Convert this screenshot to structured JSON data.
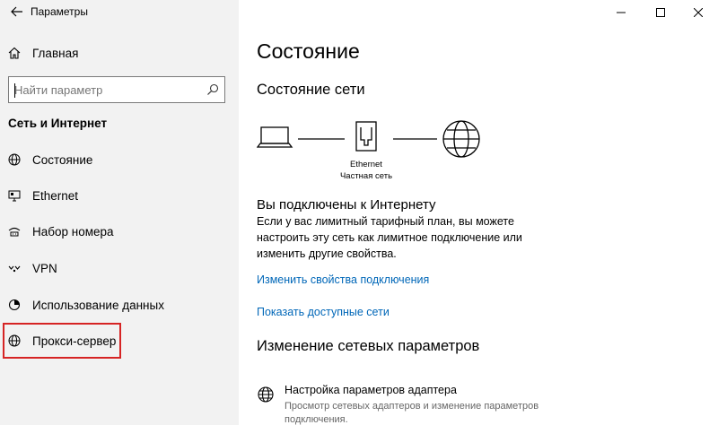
{
  "window": {
    "title": "Параметры",
    "controls": [
      "minimize-icon",
      "maximize-icon",
      "close-icon"
    ]
  },
  "sidebar": {
    "home_label": "Главная",
    "search": {
      "placeholder": "Найти параметр",
      "value": ""
    },
    "section_title": "Сеть и Интернет",
    "items": [
      {
        "label": "Состояние",
        "icon": "globe-status-icon"
      },
      {
        "label": "Ethernet",
        "icon": "ethernet-monitor-icon"
      },
      {
        "label": "Набор номера",
        "icon": "dialup-icon"
      },
      {
        "label": "VPN",
        "icon": "vpn-icon"
      },
      {
        "label": "Использование данных",
        "icon": "data-usage-icon"
      },
      {
        "label": "Прокси-сервер",
        "icon": "globe-icon",
        "highlighted": true
      }
    ]
  },
  "main": {
    "title": "Состояние",
    "network_status_heading": "Состояние сети",
    "diagram": {
      "adapter_name": "Ethernet",
      "network_type": "Частная сеть"
    },
    "connected_heading": "Вы подключены к Интернету",
    "connected_desc": "Если у вас лимитный тарифный план, вы можете настроить эту сеть как лимитное подключение или изменить другие свойства.",
    "link_change_props": "Изменить свойства подключения",
    "link_show_networks": "Показать доступные сети",
    "change_settings_heading": "Изменение сетевых параметров",
    "adapter_settings": {
      "title": "Настройка параметров адаптера",
      "subtitle": "Просмотр сетевых адаптеров и изменение параметров подключения."
    }
  },
  "colors": {
    "sidebar_bg": "#f2f2f2",
    "link": "#0067b8",
    "highlight_border": "#d62424"
  }
}
